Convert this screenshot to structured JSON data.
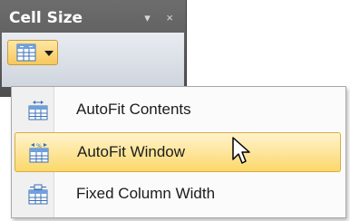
{
  "panel": {
    "title": "Cell Size",
    "pin_glyph": "▾",
    "close_glyph": "×"
  },
  "split_button": {
    "icon": "autofit-table-icon",
    "dropdown_icon": "chevron-down-icon"
  },
  "menu": {
    "items": [
      {
        "label": "AutoFit Contents",
        "icon": "autofit-contents-icon",
        "highlighted": false
      },
      {
        "label": "AutoFit Window",
        "icon": "autofit-window-icon",
        "highlighted": true
      },
      {
        "label": "Fixed Column Width",
        "icon": "fixed-column-width-icon",
        "highlighted": false
      }
    ]
  },
  "colors": {
    "panel_dark": "#5a5a5a",
    "highlight": "#fbd86b",
    "icon_blue": "#3b6fb6"
  }
}
